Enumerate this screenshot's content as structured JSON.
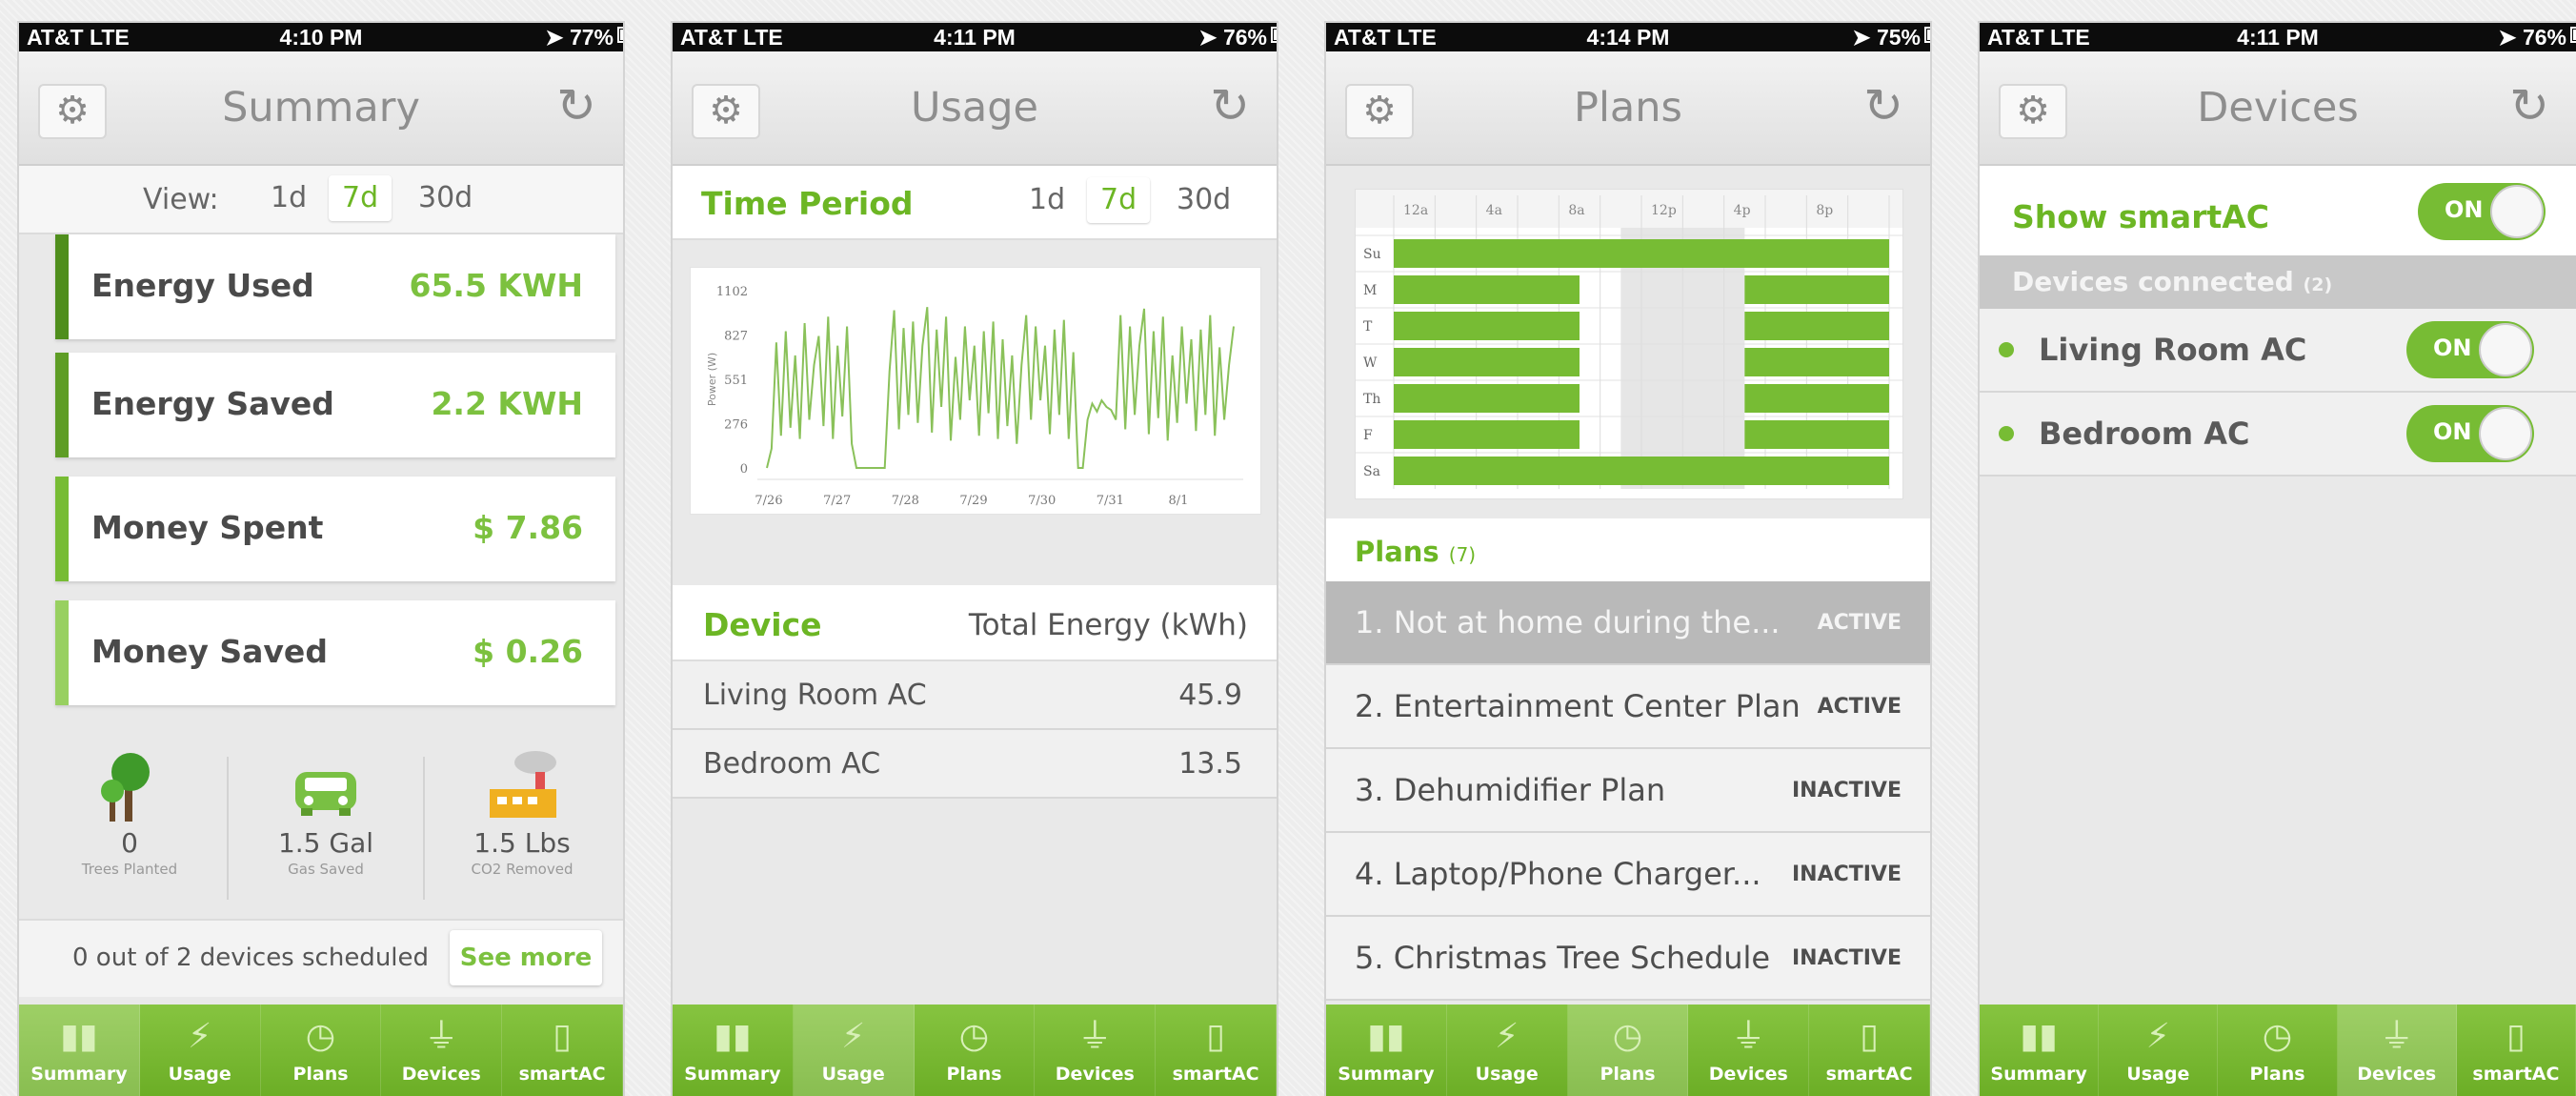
{
  "status_bars": [
    {
      "carrier": "AT&T  LTE",
      "time": "4:10 PM",
      "battery": "77%"
    },
    {
      "carrier": "AT&T  LTE",
      "time": "4:11 PM",
      "battery": "76%"
    },
    {
      "carrier": "AT&T  LTE",
      "time": "4:14 PM",
      "battery": "75%"
    },
    {
      "carrier": "AT&T  LTE",
      "time": "4:11 PM",
      "battery": "76%"
    }
  ],
  "tabs": [
    "Summary",
    "Usage",
    "Plans",
    "Devices",
    "smartAC"
  ],
  "summary": {
    "title": "Summary",
    "view_label": "View:",
    "periods": [
      "1d",
      "7d",
      "30d"
    ],
    "selected_period": "7d",
    "stats": [
      {
        "label": "Energy Used",
        "value": "65.5 KWH"
      },
      {
        "label": "Energy Saved",
        "value": "2.2 KWH"
      },
      {
        "label": "Money Spent",
        "value": "$ 7.86"
      },
      {
        "label": "Money Saved",
        "value": "$ 0.26"
      }
    ],
    "eco": [
      {
        "value": "0",
        "caption": "Trees Planted"
      },
      {
        "value": "1.5 Gal",
        "caption": "Gas Saved"
      },
      {
        "value": "1.5 Lbs",
        "caption": "CO2 Removed"
      }
    ],
    "scheduled_text": "0 out of 2 devices scheduled",
    "see_more": "See more"
  },
  "usage": {
    "title": "Usage",
    "time_period_label": "Time Period",
    "periods": [
      "1d",
      "7d",
      "30d"
    ],
    "selected_period": "7d",
    "device_header": "Device",
    "energy_header": "Total Energy (kWh)",
    "devices": [
      {
        "name": "Living Room AC",
        "energy": "45.9"
      },
      {
        "name": "Bedroom AC",
        "energy": "13.5"
      }
    ]
  },
  "plans": {
    "title": "Plans",
    "schedule_hours": [
      "12a",
      "4a",
      "8a",
      "12p",
      "4p",
      "8p"
    ],
    "schedule_days": [
      "Su",
      "M",
      "T",
      "W",
      "Th",
      "F",
      "Sa"
    ],
    "plans_label": "Plans",
    "plans_count": "(7)",
    "items": [
      {
        "name": "1. Not at home during the...",
        "status": "ACTIVE"
      },
      {
        "name": "2. Entertainment Center Plan",
        "status": "ACTIVE"
      },
      {
        "name": "3. Dehumidifier Plan",
        "status": "INACTIVE"
      },
      {
        "name": "4. Laptop/Phone Charger...",
        "status": "INACTIVE"
      },
      {
        "name": "5. Christmas Tree Schedule",
        "status": "INACTIVE"
      }
    ]
  },
  "devices": {
    "title": "Devices",
    "show_label": "Show smartAC",
    "show_toggle": "ON",
    "connected_label": "Devices connected",
    "connected_count": "(2)",
    "items": [
      {
        "name": "Living Room AC",
        "toggle": "ON"
      },
      {
        "name": "Bedroom AC",
        "toggle": "ON"
      }
    ]
  },
  "chart_data": {
    "type": "line",
    "ylabel": "Power (W)",
    "yticks": [
      0,
      276,
      551,
      827,
      1102
    ],
    "ylim": [
      0,
      1102
    ],
    "xticks": [
      "7/26",
      "7/27",
      "7/28",
      "7/29",
      "7/30",
      "7/31",
      "8/1"
    ],
    "color": "#8ac15a",
    "series": [
      {
        "values": [
          0,
          120,
          780,
          200,
          850,
          250,
          700,
          180,
          900,
          300,
          640,
          820,
          260,
          940,
          180,
          760,
          320,
          880,
          150,
          0,
          0,
          0,
          0,
          0,
          0,
          0,
          600,
          980,
          240,
          870,
          330,
          910,
          280,
          760,
          1000,
          220,
          860,
          380,
          940,
          170,
          690,
          300,
          880,
          420,
          760,
          200,
          850,
          340,
          910,
          180,
          800,
          260,
          700,
          150,
          640,
          950,
          300,
          880,
          420,
          760,
          210,
          860,
          330,
          920,
          180,
          720,
          0,
          0,
          300,
          400,
          350,
          420,
          380,
          360,
          300,
          950,
          240,
          880,
          330,
          760,
          990,
          210,
          850,
          310,
          940,
          170,
          700,
          280,
          880,
          400,
          800,
          230,
          860,
          330,
          950,
          200,
          750,
          300,
          640,
          880
        ]
      }
    ]
  },
  "colors": {
    "brand_green": "#77bc34",
    "dark_green": "#4f8e1c",
    "accent_text": "#6cb624"
  }
}
